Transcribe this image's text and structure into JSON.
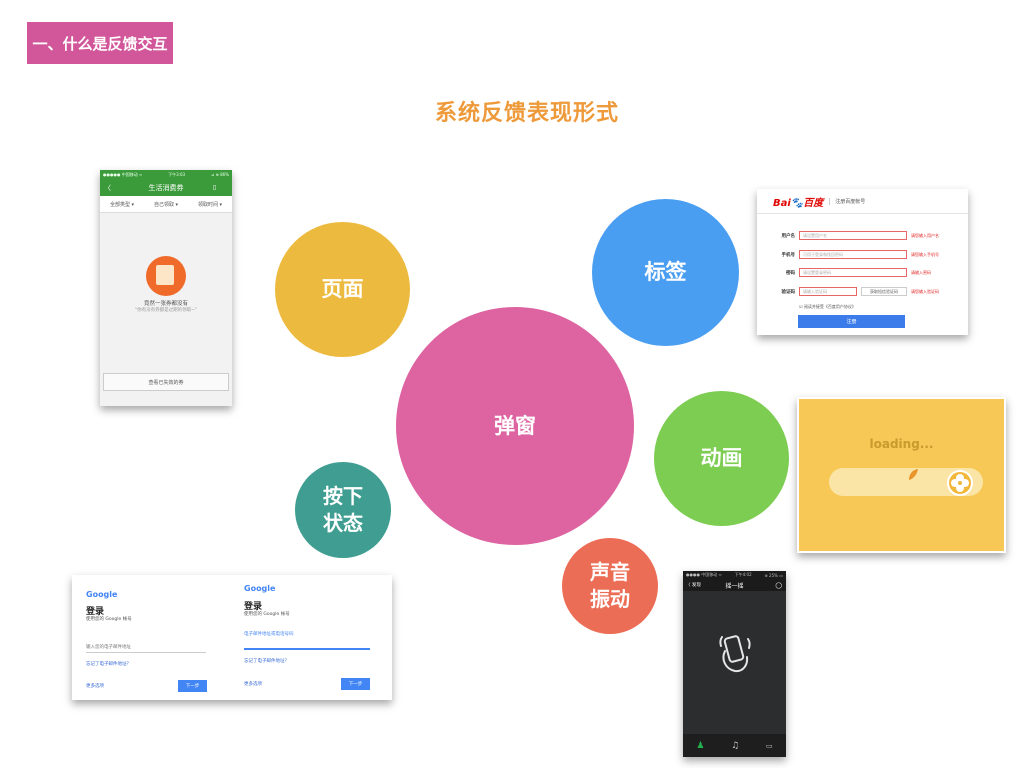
{
  "section_tag": "一、什么是反馈交互",
  "title": "系统反馈表现形式",
  "bubbles": [
    {
      "label": "页面",
      "color": "#ecba3e"
    },
    {
      "label": "标签",
      "color": "#4a9ef2"
    },
    {
      "label": "弹窗",
      "color": "#dd63a1"
    },
    {
      "label": "动画",
      "color": "#7ccd52"
    },
    {
      "label": "按下\n状态",
      "color": "#3f9e91"
    },
    {
      "label": "声音\n振动",
      "color": "#ec6d56"
    }
  ],
  "phone_coupons": {
    "status_left": "●●●●● 中国移动 ≈",
    "status_time": "下午3:03",
    "status_right": "⊿ ⊕ 86%",
    "nav_title": "生活消费券",
    "filters": [
      "全部类型 ▾",
      "自己领取 ▾",
      "领取时间 ▾"
    ],
    "empty_title": "竟然一张券都没有",
    "empty_sub": "“你有没有券都是过期的领取~”",
    "button": "查看已失效的券"
  },
  "baidu_form": {
    "logo_text": "Bai",
    "logo_suffix": "百度",
    "header": "注册百度帐号",
    "rows": [
      {
        "label": "用户名",
        "placeholder": "请设置用户名",
        "error": "请您输入用户名"
      },
      {
        "label": "手机号",
        "placeholder": "可用于登录和找回密码",
        "error": "请您输入手机号"
      },
      {
        "label": "密码",
        "placeholder": "请设置登录密码",
        "error": "请输入密码"
      },
      {
        "label": "验证码",
        "placeholder": "请输入验证码",
        "extra": "获取短信验证码",
        "error": "请您输入验证码"
      }
    ],
    "agree": "阅读并接受《百度用户协议》",
    "submit": "注册"
  },
  "loading_card": {
    "text": "loading..."
  },
  "google_login": {
    "logo": "Google",
    "heading": "登录",
    "subheading": "使用您的 Google 帐号",
    "left_field": "输入您的电子邮件地址",
    "right_field": "电子邮件地址或电话号码",
    "forgot": "忘记了电子邮件地址？",
    "more": "更多选项",
    "next": "下一步"
  },
  "phone_shake": {
    "status_left": "●●●● 中国移动 ≈",
    "status_time": "下午4:02",
    "status_right": "⊕ 25% ▭",
    "back": "〈 发现",
    "nav_title": "摇一摇",
    "tabs": [
      "人",
      "歌曲",
      "电视"
    ]
  }
}
